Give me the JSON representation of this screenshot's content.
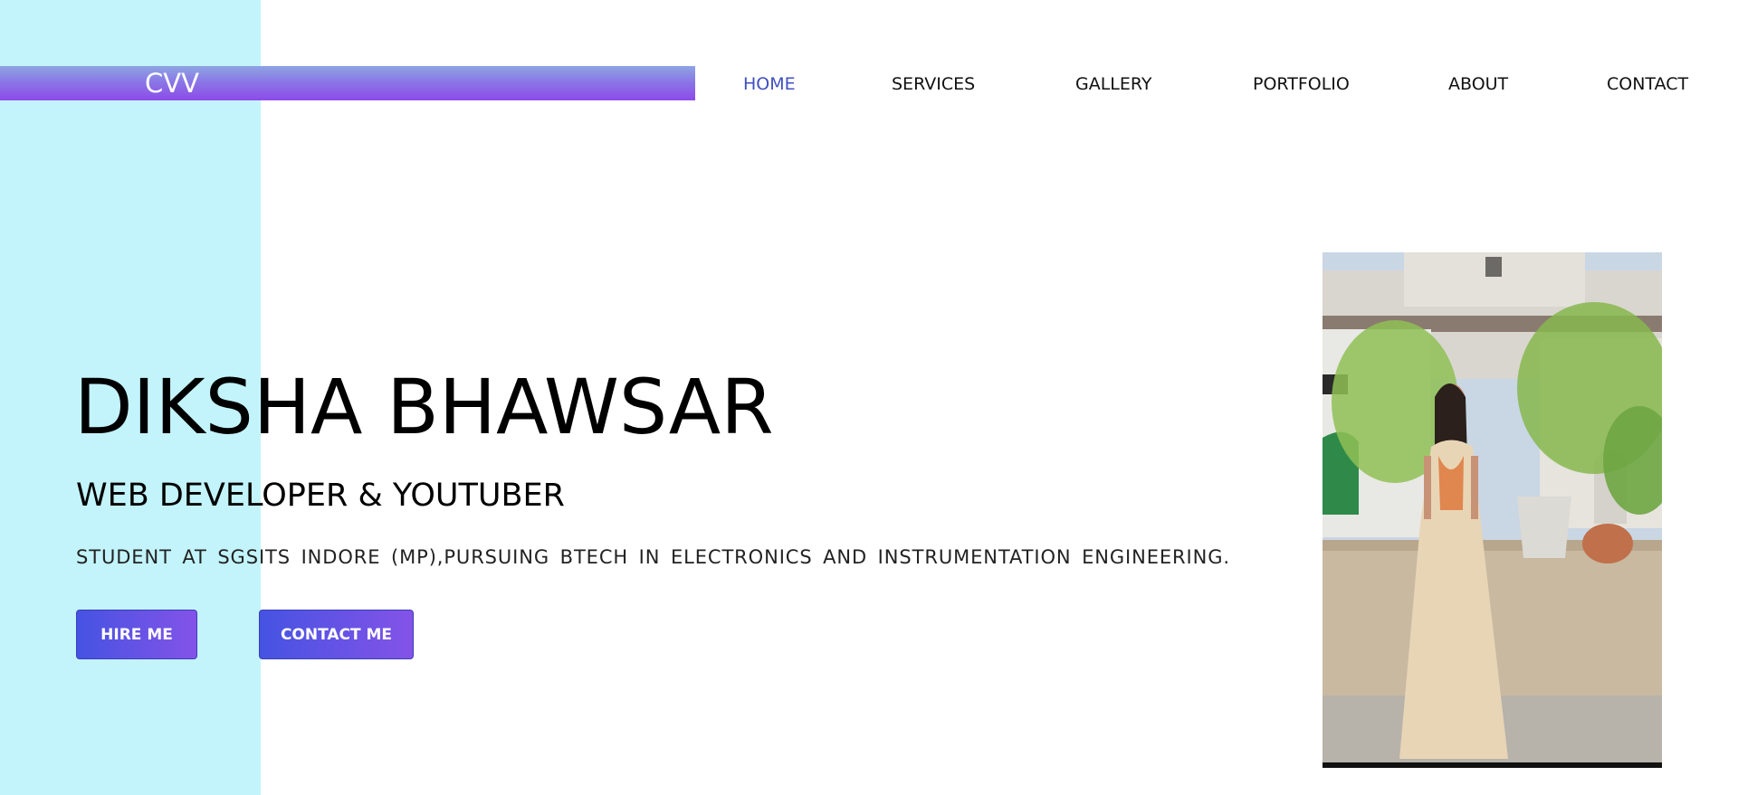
{
  "logo": {
    "text": "CVV"
  },
  "nav": {
    "items": [
      {
        "label": "HOME",
        "active": true
      },
      {
        "label": "SERVICES",
        "active": false
      },
      {
        "label": "GALLERY",
        "active": false
      },
      {
        "label": "PORTFOLIO",
        "active": false
      },
      {
        "label": "ABOUT",
        "active": false
      },
      {
        "label": "CONTACT",
        "active": false
      }
    ]
  },
  "hero": {
    "name": "DIKSHA BHAWSAR",
    "role": "WEB DEVELOPER & YOUTUBER",
    "description": "STUDENT AT SGSITS INDORE (MP),PURSUING BTECH IN ELECTRONICS AND INSTRUMENTATION ENGINEERING.",
    "buttons": {
      "hire_label": "HIRE ME",
      "contact_label": "CONTACT ME"
    }
  },
  "colors": {
    "side_accent": "#c3f4fb",
    "nav_active": "#4050c0",
    "button_gradient_start": "#4553e2",
    "button_gradient_end": "#8453e8"
  }
}
